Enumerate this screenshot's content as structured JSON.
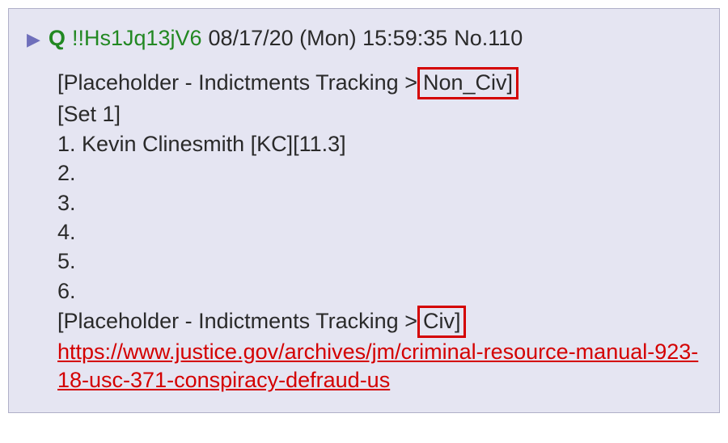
{
  "header": {
    "triangle": "▶",
    "name": "Q",
    "trip": "!!Hs1Jq13jV6",
    "timestamp": "08/17/20 (Mon) 15:59:35",
    "post_no": "No.110"
  },
  "body": {
    "line1_pre": "[Placeholder - Indictments Tracking >",
    "line1_box": " Non_Civ]",
    "line2": "[Set 1]",
    "line3": "1. Kevin Clinesmith [KC][11.3]",
    "line4": "2.",
    "line5": "3.",
    "line6": "4.",
    "line7": "5.",
    "line8": "6.",
    "line9_pre": "[Placeholder - Indictments Tracking >",
    "line9_box": " Civ]",
    "link": "https://www.justice.gov/archives/jm/criminal-resource-manual-923-18-usc-371-conspiracy-defraud-us"
  }
}
